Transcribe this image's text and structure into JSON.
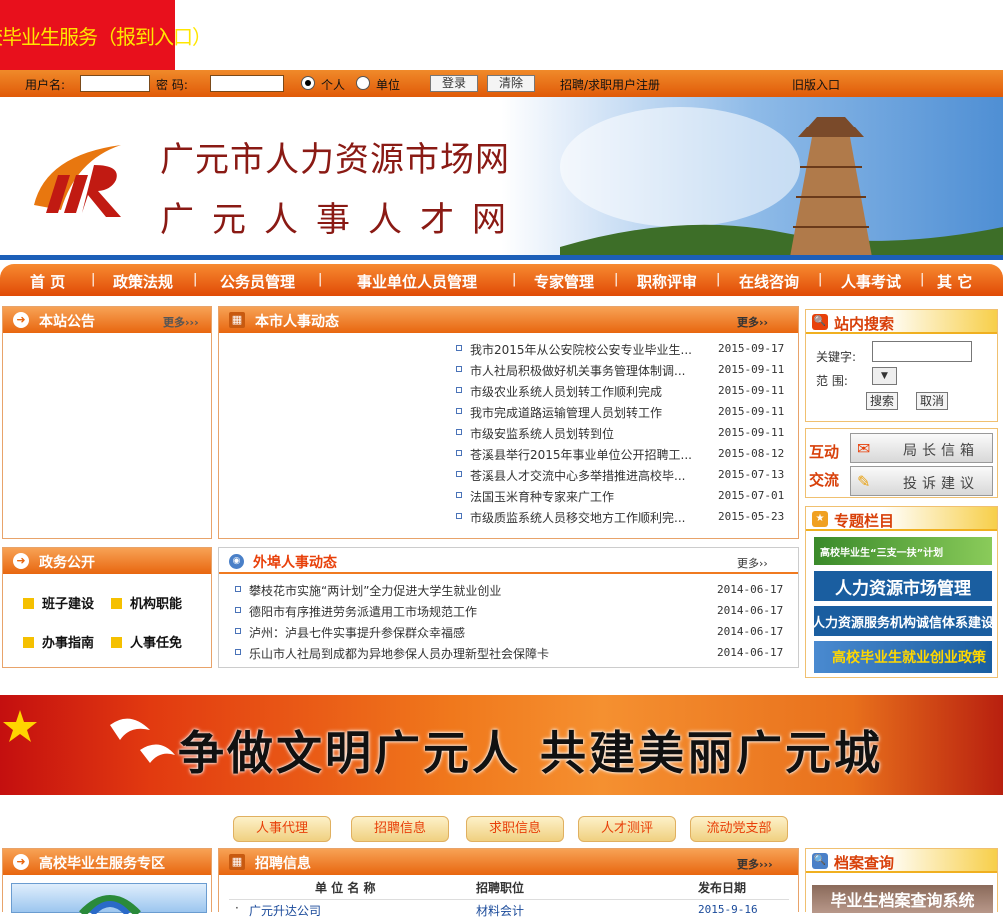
{
  "promo": {
    "text": "高校毕业生服务（报到入口）"
  },
  "login": {
    "username_label": "用户名:",
    "password_label": "密  码:",
    "radio_personal": "个人",
    "radio_unit": "单位",
    "login_button": "登录",
    "clear_button": "清除",
    "register_link": "招聘/求职用户注册",
    "old_version_link": "旧版入口"
  },
  "banner": {
    "line1": "广元市人力资源市场网",
    "line2": "广元人事人才网"
  },
  "nav": [
    "首  页",
    "政策法规",
    "公务员管理",
    "事业单位人员管理",
    "专家管理",
    "职称评审",
    "在线咨询",
    "人事考试",
    "其  它"
  ],
  "notice": {
    "title": "本站公告",
    "more": "更多›››"
  },
  "local_news": {
    "title": "本市人事动态",
    "more": "更多››",
    "items": [
      {
        "title": "我市2015年从公安院校公安专业毕业生...",
        "date": "2015-09-17"
      },
      {
        "title": "市人社局积极做好机关事务管理体制调...",
        "date": "2015-09-11"
      },
      {
        "title": "市级农业系统人员划转工作顺利完成",
        "date": "2015-09-11"
      },
      {
        "title": "我市完成道路运输管理人员划转工作",
        "date": "2015-09-11"
      },
      {
        "title": "市级安监系统人员划转到位",
        "date": "2015-09-11"
      },
      {
        "title": "苍溪县举行2015年事业单位公开招聘工...",
        "date": "2015-08-12"
      },
      {
        "title": "苍溪县人才交流中心多举措推进高校毕...",
        "date": "2015-07-13"
      },
      {
        "title": "法国玉米育种专家来广工作",
        "date": "2015-07-01"
      },
      {
        "title": "市级质监系统人员移交地方工作顺利完...",
        "date": "2015-05-23"
      }
    ]
  },
  "search": {
    "title": "站内搜索",
    "keyword_label": "关键字:",
    "range_label": "范  围:",
    "search_button": "搜索",
    "cancel_button": "取消"
  },
  "interact": {
    "label1": "互动",
    "label2": "交流",
    "mailbox": "局长信箱",
    "complaint": "投诉建议"
  },
  "gov_affairs": {
    "title": "政务公开",
    "items": [
      "班子建设",
      "机构职能",
      "办事指南",
      "人事任免"
    ]
  },
  "outside_news": {
    "title": "外埠人事动态",
    "more": "更多››",
    "items": [
      {
        "title": "攀枝花市实施“两计划”全力促进大学生就业创业",
        "date": "2014-06-17"
      },
      {
        "title": "德阳市有序推进劳务派遣用工市场规范工作",
        "date": "2014-06-17"
      },
      {
        "title": "泸州：泸县七件实事提升参保群众幸福感",
        "date": "2014-06-17"
      },
      {
        "title": "乐山市人社局到成都为异地参保人员办理新型社会保障卡",
        "date": "2014-06-17"
      }
    ]
  },
  "topics": {
    "title": "专题栏目",
    "items": [
      "高校毕业生“三支一扶”计划",
      "人力资源市场管理",
      "人力资源服务机构诚信体系建设",
      "高校毕业生就业创业政策"
    ]
  },
  "slogan": {
    "text": "争做文明广元人  共建美丽广元城"
  },
  "tabs": [
    "人事代理",
    "招聘信息",
    "求职信息",
    "人才测评",
    "流动党支部"
  ],
  "grad_zone": {
    "title": "高校毕业生服务专区"
  },
  "jobs": {
    "title": "招聘信息",
    "more": "更多›››",
    "col_unit": "单 位 名 称",
    "col_position": "招聘职位",
    "col_date": "发布日期",
    "rows": [
      {
        "unit": "广元升达公司",
        "position": "材料会计",
        "date": "2015-9-16"
      }
    ]
  },
  "archive": {
    "title": "档案查询",
    "system": "毕业生档案查询系统"
  }
}
